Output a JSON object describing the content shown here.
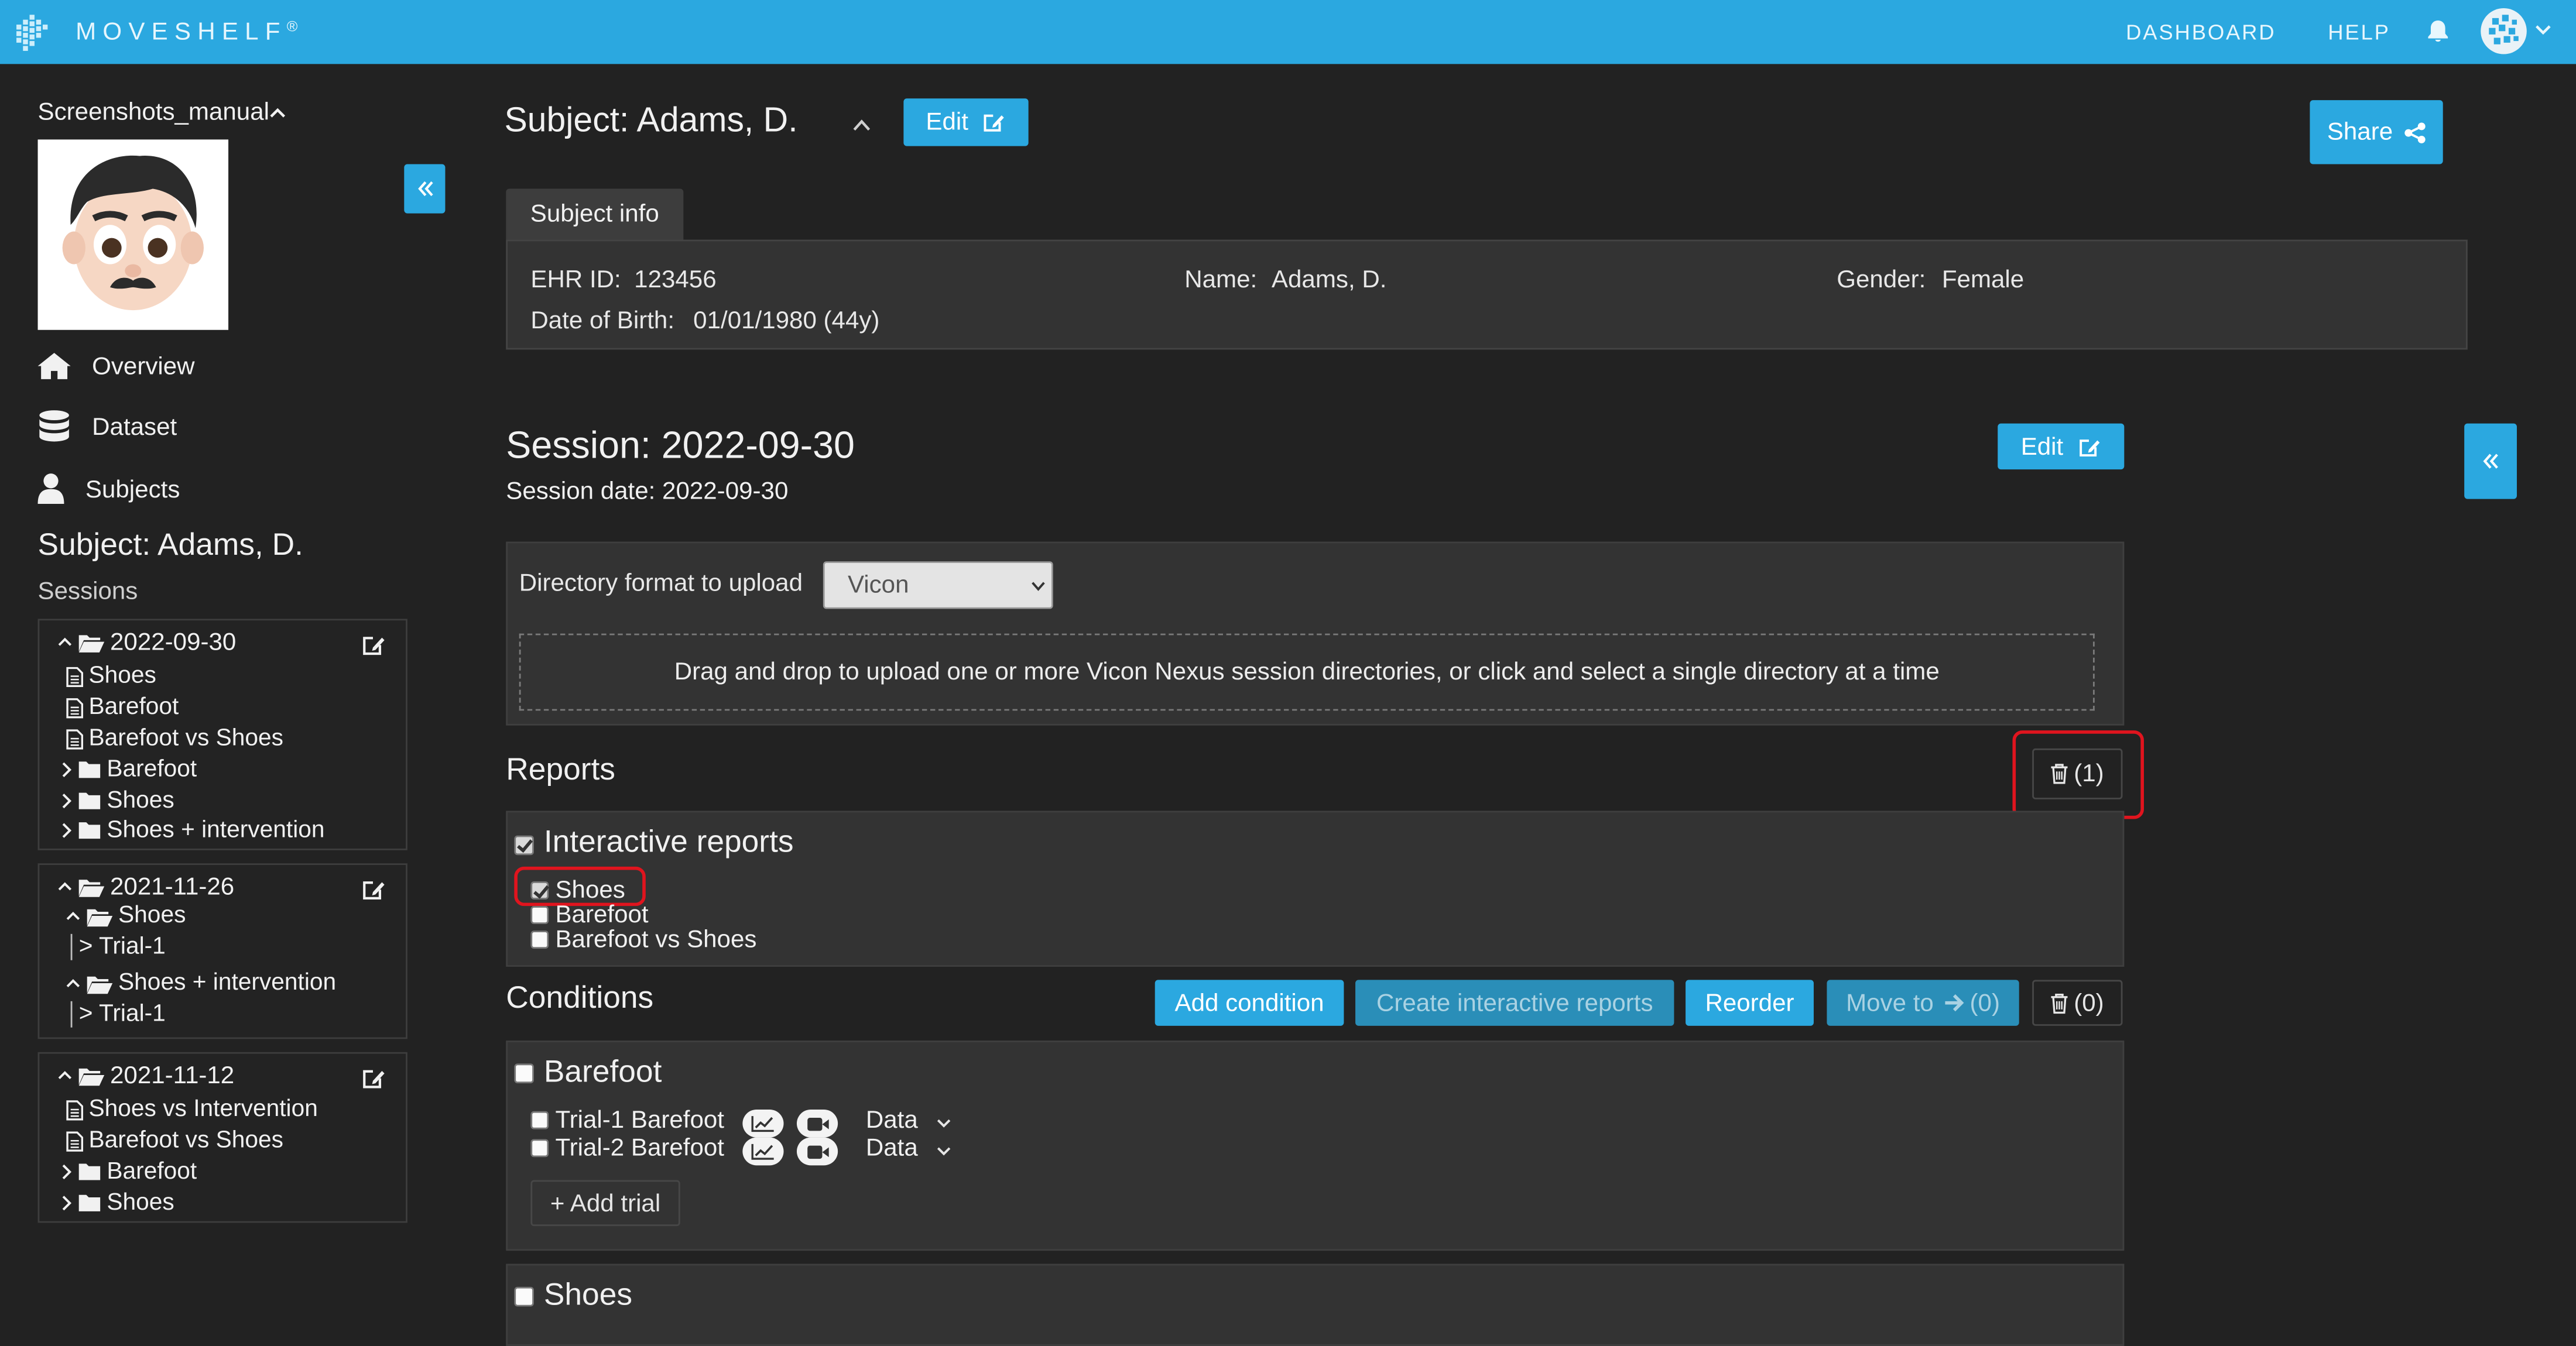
{
  "navbar": {
    "brand": "MOVESHELF",
    "brand_mark": "®",
    "links": [
      "DASHBOARD",
      "HELP"
    ],
    "icons": [
      "bell-icon",
      "user-avatar-icon",
      "chevron-down-icon"
    ]
  },
  "sidebar": {
    "project": "Screenshots_manual",
    "nav": [
      "Overview",
      "Dataset",
      "Subjects"
    ],
    "subject_heading": "Subject: Adams, D.",
    "sessions_label": "Sessions",
    "sessions": [
      {
        "date": "2022-09-30",
        "items": [
          {
            "type": "file",
            "label": "Shoes"
          },
          {
            "type": "file",
            "label": "Barefoot"
          },
          {
            "type": "file",
            "label": "Barefoot vs Shoes"
          },
          {
            "type": "folder",
            "label": "Barefoot"
          },
          {
            "type": "folder",
            "label": "Shoes"
          },
          {
            "type": "folder",
            "label": "Shoes + intervention"
          }
        ]
      },
      {
        "date": "2021-11-26",
        "items": [
          {
            "type": "open-folder",
            "label": "Shoes"
          },
          {
            "type": "trial",
            "label": "> Trial-1"
          },
          {
            "type": "open-folder",
            "label": "Shoes + intervention"
          },
          {
            "type": "trial",
            "label": "> Trial-1"
          }
        ]
      },
      {
        "date": "2021-11-12",
        "items": [
          {
            "type": "file",
            "label": "Shoes vs Intervention"
          },
          {
            "type": "file",
            "label": "Barefoot vs Shoes"
          },
          {
            "type": "folder",
            "label": "Barefoot"
          },
          {
            "type": "folder",
            "label": "Shoes"
          }
        ]
      }
    ]
  },
  "subject": {
    "title": "Subject: Adams, D.",
    "edit_label": "Edit",
    "share_label": "Share",
    "tab": "Subject info",
    "fields": {
      "ehr_label": "EHR ID:",
      "ehr_value": "123456",
      "name_label": "Name:",
      "name_value": "Adams, D.",
      "gender_label": "Gender:",
      "gender_value": "Female",
      "dob_label": "Date of Birth:",
      "dob_value": "01/01/1980 (44y)"
    }
  },
  "session": {
    "title": "Session: 2022-09-30",
    "date_line": "Session date: 2022-09-30",
    "edit_label": "Edit",
    "upload_format_label": "Directory format to upload",
    "upload_format_value": "Vicon",
    "dropzone_text": "Drag and drop to upload one or more Vicon Nexus session directories, or click and select a single directory at a time"
  },
  "reports": {
    "heading": "Reports",
    "delete_count": "(1)",
    "group_label": "Interactive reports",
    "items": [
      {
        "label": "Shoes",
        "checked": true
      },
      {
        "label": "Barefoot",
        "checked": false
      },
      {
        "label": "Barefoot vs Shoes",
        "checked": false
      }
    ]
  },
  "conditions": {
    "heading": "Conditions",
    "buttons": {
      "add": "Add condition",
      "create": "Create interactive reports",
      "reorder": "Reorder",
      "move": "Move to",
      "move_count": "(0)",
      "delete_count": "(0)"
    },
    "list": [
      {
        "name": "Barefoot",
        "trials": [
          {
            "name": "Trial-1 Barefoot",
            "data_label": "Data"
          },
          {
            "name": "Trial-2 Barefoot",
            "data_label": "Data"
          }
        ],
        "add_trial": "+ Add trial"
      },
      {
        "name": "Shoes"
      }
    ]
  },
  "colors": {
    "accent": "#2ba8e0",
    "background": "#222222",
    "panel": "#333333",
    "highlight": "#e0141e"
  }
}
